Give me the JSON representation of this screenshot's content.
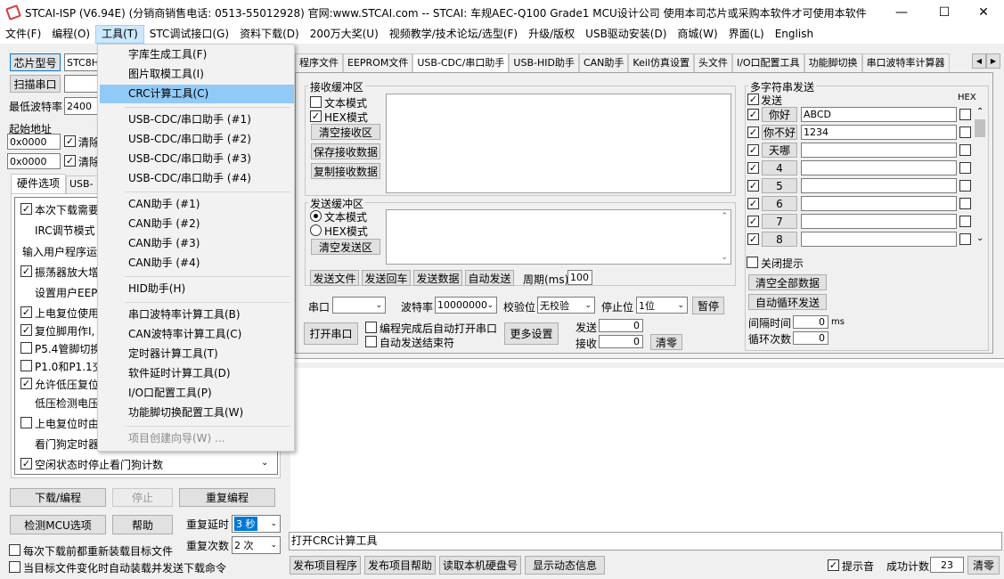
{
  "window": {
    "title": "STCAI-ISP (V6.94E) (分销商销售电话: 0513-55012928) 官网:www.STCAI.com  -- STCAI: 车规AEC-Q100 Grade1 MCU设计公司 使用本司芯片或采购本软件才可使用本软件",
    "minimize": "—",
    "maximize": "☐",
    "close": "✕"
  },
  "menubar": [
    "文件(F)",
    "编程(O)",
    "工具(T)",
    "STC调试接口(G)",
    "资料下载(D)",
    "200万大奖(U)",
    "视频教学/技术论坛/选型(F)",
    "升级/版权",
    "USB驱动安装(D)",
    "商城(W)",
    "界面(L)",
    "English"
  ],
  "tools_menu": {
    "group1": [
      "字库生成工具(F)",
      "图片取模工具(I)",
      "CRC计算工具(C)"
    ],
    "group2": [
      "USB-CDC/串口助手 (#1)",
      "USB-CDC/串口助手 (#2)",
      "USB-CDC/串口助手 (#3)",
      "USB-CDC/串口助手 (#4)"
    ],
    "group3": [
      "CAN助手 (#1)",
      "CAN助手 (#2)",
      "CAN助手 (#3)",
      "CAN助手 (#4)"
    ],
    "group4": [
      "HID助手(H)"
    ],
    "group5": [
      "串口波特率计算工具(B)",
      "CAN波特率计算工具(C)",
      "定时器计算工具(T)",
      "软件延时计算工具(D)",
      "I/O口配置工具(P)",
      "功能脚切换配置工具(W)"
    ],
    "group6": [
      "项目创建向导(W) ..."
    ]
  },
  "left": {
    "chip_model_btn": "芯片型号",
    "chip_model_value": "STC8H",
    "scan_port_btn": "扫描串口",
    "min_baud_label": "最低波特率",
    "min_baud_value": "2400",
    "start_addr_label": "起始地址",
    "addr1": "0x0000",
    "clear1": "清除",
    "addr2": "0x0000",
    "clear2": "清除",
    "tab_hw": "硬件选项",
    "tab_usb": "USB-L",
    "hw_options": [
      {
        "text": "本次下载需要",
        "check": "✓"
      },
      {
        "text": "IRC调节模式",
        "check": ""
      },
      {
        "text": "输入用户程序运",
        "check": ""
      },
      {
        "text": "振荡器放大增",
        "check": "✓"
      },
      {
        "text": "设置用户EEPI",
        "check": ""
      },
      {
        "text": "上电复位使用",
        "check": "✓"
      },
      {
        "text": "复位脚用作I,",
        "check": "✓"
      },
      {
        "text": "P5.4管脚切换",
        "check": ""
      },
      {
        "text": "P1.0和P1.1交",
        "check": ""
      },
      {
        "text": "允许低压复位",
        "check": "✓"
      },
      {
        "text": "低压检测电压",
        "check": ""
      },
      {
        "text": "上电复位时由",
        "check": ""
      },
      {
        "text": "看门狗定时器",
        "check": ""
      },
      {
        "text": "空闲状态时停止看门狗计数",
        "check": "✓"
      }
    ],
    "download_btn": "下载/编程",
    "stop_btn": "停止",
    "reprogram_btn": "重复编程",
    "check_mcu_btn": "检测MCU选项",
    "help_btn": "帮助",
    "repeat_delay_label": "重复延时",
    "repeat_delay_value": "3 秒",
    "repeat_count_label": "重复次数",
    "repeat_count_value": "2 次",
    "reload_each": "每次下载前都重新装载目标文件",
    "auto_reload": "当目标文件变化时自动装载并发送下载命令"
  },
  "tabs": [
    "程序文件",
    "EEPROM文件",
    "USB-CDC/串口助手",
    "USB-HID助手",
    "CAN助手",
    "Keil仿真设置",
    "头文件",
    "I/O口配置工具",
    "功能脚切换",
    "串口波特率计算器"
  ],
  "recv": {
    "title": "接收缓冲区",
    "text_mode": "文本模式",
    "hex_mode": "HEX模式",
    "clear": "清空接收区",
    "save": "保存接收数据",
    "copy": "复制接收数据"
  },
  "send": {
    "title": "发送缓冲区",
    "text_mode": "文本模式",
    "hex_mode": "HEX模式",
    "clear": "清空发送区",
    "send_file": "发送文件",
    "send_enter": "发送回车",
    "send_data": "发送数据",
    "auto_send": "自动发送",
    "period_label": "周期(ms)",
    "period_value": "100"
  },
  "port": {
    "port_label": "串口",
    "baud_label": "波特率",
    "baud_value": "10000000",
    "parity_label": "校验位",
    "parity_value": "无校验",
    "stop_label": "停止位",
    "stop_value": "1位",
    "pause": "暂停",
    "open": "打开串口",
    "auto_open": "编程完成后自动打开串口",
    "auto_end": "自动发送结束符",
    "more": "更多设置",
    "send_label": "发送",
    "send_count": "0",
    "recv_label": "接收",
    "recv_count": "0",
    "clear": "清零"
  },
  "multi": {
    "title": "多字符串发送",
    "send_col": "发送",
    "hex_col": "HEX",
    "rows": [
      {
        "btn": "你好",
        "value": "ABCD"
      },
      {
        "btn": "你不好",
        "value": "1234"
      },
      {
        "btn": "天哪",
        "value": ""
      },
      {
        "btn": "4",
        "value": ""
      },
      {
        "btn": "5",
        "value": ""
      },
      {
        "btn": "6",
        "value": ""
      },
      {
        "btn": "7",
        "value": ""
      },
      {
        "btn": "8",
        "value": ""
      }
    ],
    "close_tip": "关闭提示",
    "clear_all": "清空全部数据",
    "auto_loop": "自动循环发送",
    "interval_label": "间隔时间",
    "interval_value": "0",
    "interval_unit": "ms",
    "loop_label": "循环次数",
    "loop_value": "0"
  },
  "status": {
    "text": "打开CRC计算工具",
    "publish_prog": "发布项目程序",
    "publish_help": "发布项目帮助",
    "read_disk": "读取本机硬盘号",
    "show_info": "显示动态信息",
    "tone": "提示音",
    "success_label": "成功计数",
    "success_value": "23",
    "clear": "清零"
  }
}
